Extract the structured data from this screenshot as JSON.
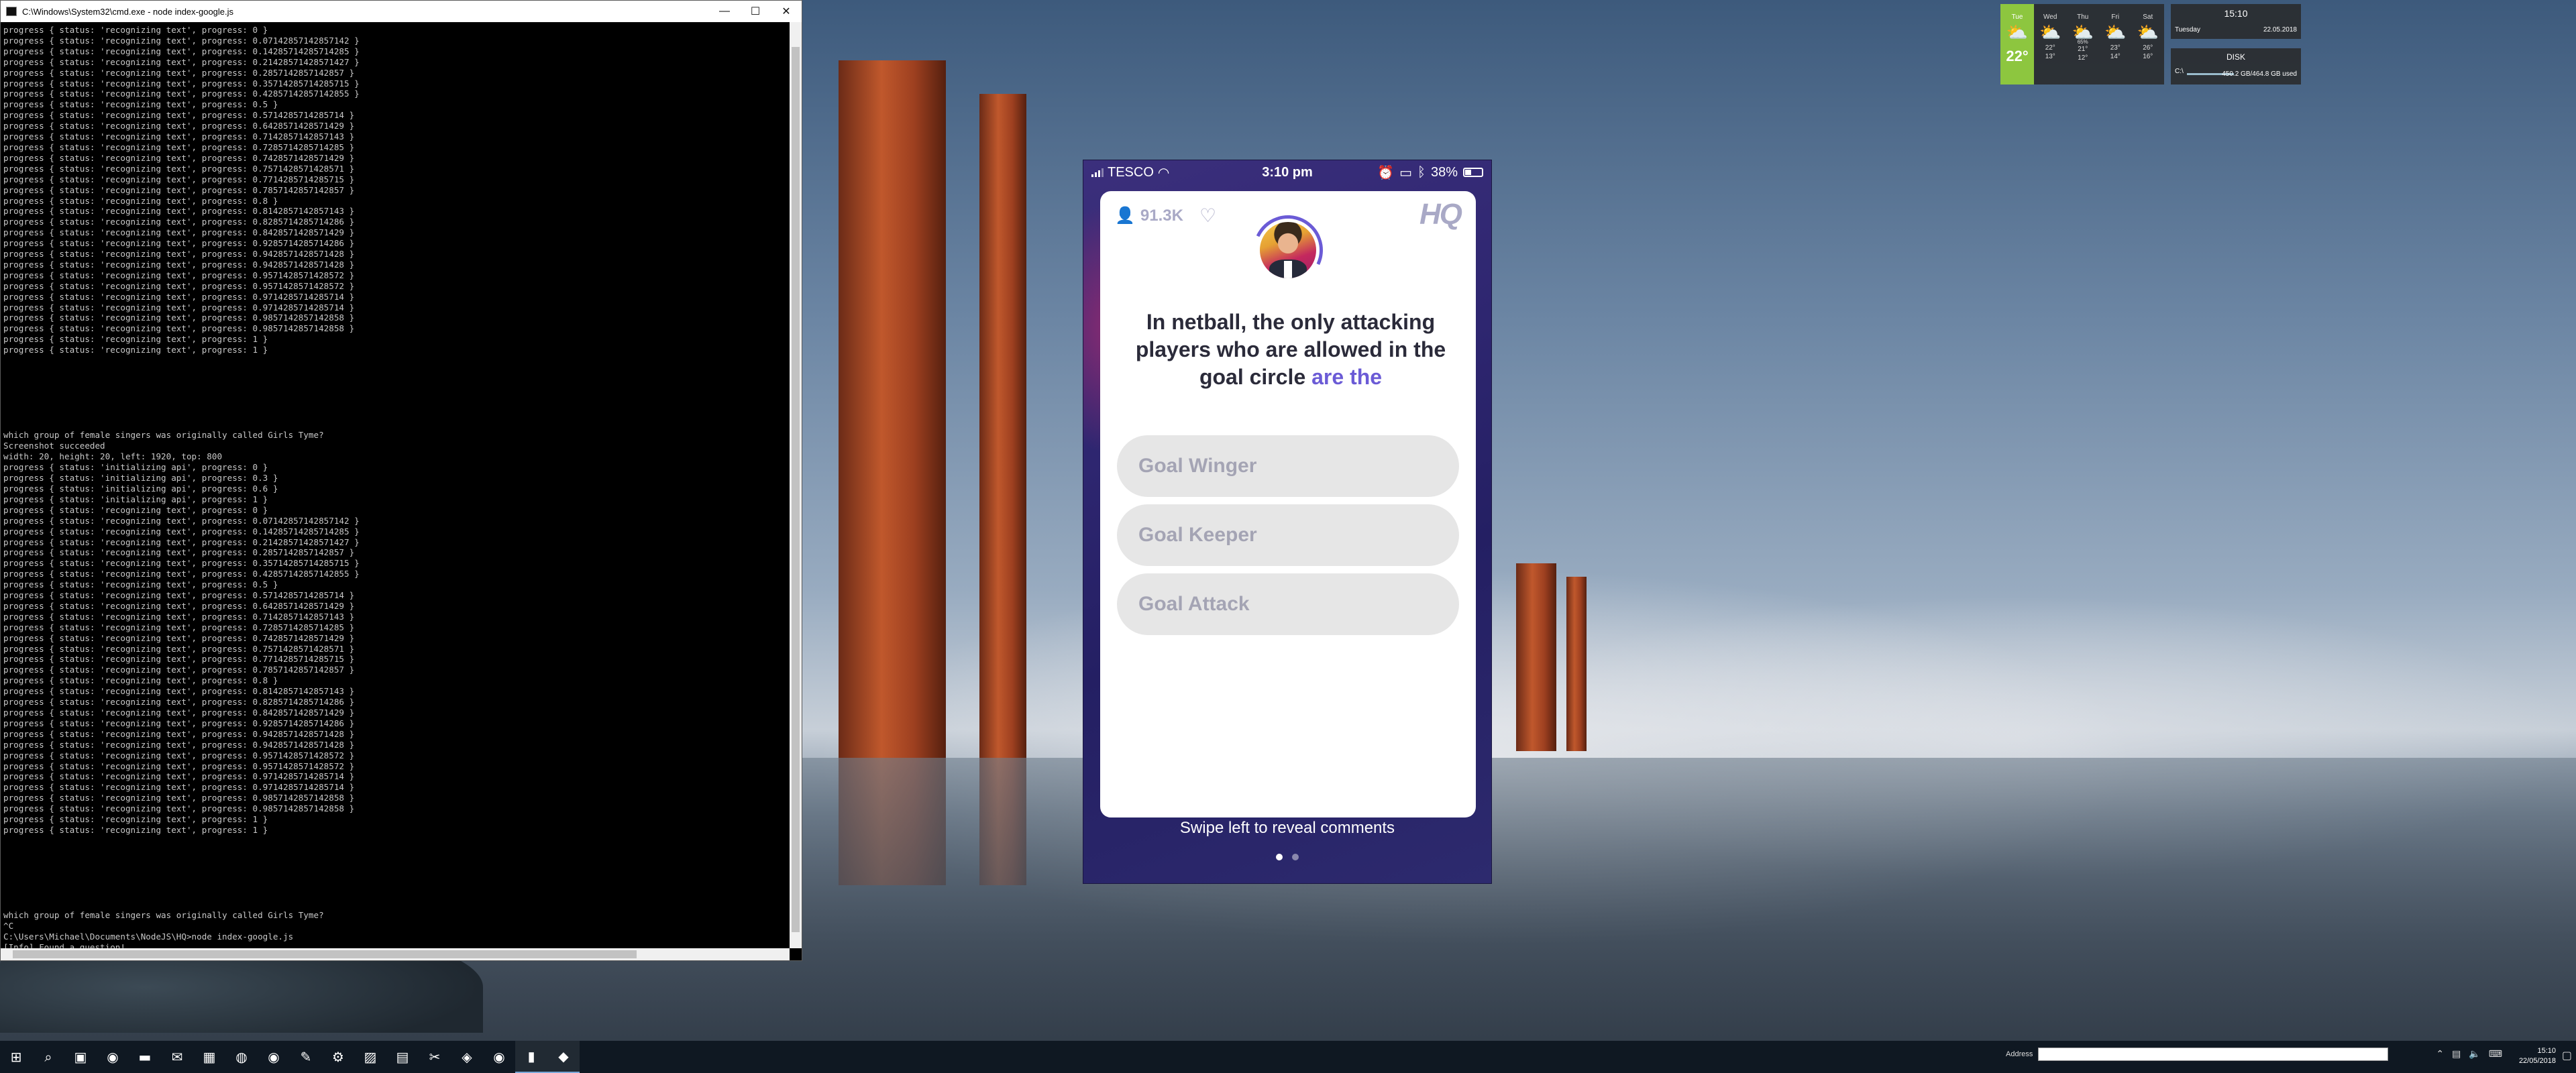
{
  "console": {
    "title": "C:\\Windows\\System32\\cmd.exe - node  index-google.js",
    "lines": [
      "progress { status: 'recognizing text', progress: 0 }",
      "progress { status: 'recognizing text', progress: 0.07142857142857142 }",
      "progress { status: 'recognizing text', progress: 0.14285714285714285 }",
      "progress { status: 'recognizing text', progress: 0.21428571428571427 }",
      "progress { status: 'recognizing text', progress: 0.2857142857142857 }",
      "progress { status: 'recognizing text', progress: 0.35714285714285715 }",
      "progress { status: 'recognizing text', progress: 0.42857142857142855 }",
      "progress { status: 'recognizing text', progress: 0.5 }",
      "progress { status: 'recognizing text', progress: 0.5714285714285714 }",
      "progress { status: 'recognizing text', progress: 0.6428571428571429 }",
      "progress { status: 'recognizing text', progress: 0.7142857142857143 }",
      "progress { status: 'recognizing text', progress: 0.7285714285714285 }",
      "progress { status: 'recognizing text', progress: 0.7428571428571429 }",
      "progress { status: 'recognizing text', progress: 0.7571428571428571 }",
      "progress { status: 'recognizing text', progress: 0.7714285714285715 }",
      "progress { status: 'recognizing text', progress: 0.7857142857142857 }",
      "progress { status: 'recognizing text', progress: 0.8 }",
      "progress { status: 'recognizing text', progress: 0.8142857142857143 }",
      "progress { status: 'recognizing text', progress: 0.8285714285714286 }",
      "progress { status: 'recognizing text', progress: 0.8428571428571429 }",
      "progress { status: 'recognizing text', progress: 0.9285714285714286 }",
      "progress { status: 'recognizing text', progress: 0.9428571428571428 }",
      "progress { status: 'recognizing text', progress: 0.9428571428571428 }",
      "progress { status: 'recognizing text', progress: 0.9571428571428572 }",
      "progress { status: 'recognizing text', progress: 0.9571428571428572 }",
      "progress { status: 'recognizing text', progress: 0.9714285714285714 }",
      "progress { status: 'recognizing text', progress: 0.9714285714285714 }",
      "progress { status: 'recognizing text', progress: 0.9857142857142858 }",
      "progress { status: 'recognizing text', progress: 0.9857142857142858 }",
      "progress { status: 'recognizing text', progress: 1 }",
      "progress { status: 'recognizing text', progress: 1 }",
      "",
      "",
      "",
      "",
      "",
      "",
      "",
      "which group of female singers was originally called Girls Tyme?",
      "Screenshot succeeded",
      "width: 20, height: 20, left: 1920, top: 800",
      "progress { status: 'initializing api', progress: 0 }",
      "progress { status: 'initializing api', progress: 0.3 }",
      "progress { status: 'initializing api', progress: 0.6 }",
      "progress { status: 'initializing api', progress: 1 }",
      "progress { status: 'recognizing text', progress: 0 }",
      "progress { status: 'recognizing text', progress: 0.07142857142857142 }",
      "progress { status: 'recognizing text', progress: 0.14285714285714285 }",
      "progress { status: 'recognizing text', progress: 0.21428571428571427 }",
      "progress { status: 'recognizing text', progress: 0.2857142857142857 }",
      "progress { status: 'recognizing text', progress: 0.35714285714285715 }",
      "progress { status: 'recognizing text', progress: 0.42857142857142855 }",
      "progress { status: 'recognizing text', progress: 0.5 }",
      "progress { status: 'recognizing text', progress: 0.5714285714285714 }",
      "progress { status: 'recognizing text', progress: 0.6428571428571429 }",
      "progress { status: 'recognizing text', progress: 0.7142857142857143 }",
      "progress { status: 'recognizing text', progress: 0.7285714285714285 }",
      "progress { status: 'recognizing text', progress: 0.7428571428571429 }",
      "progress { status: 'recognizing text', progress: 0.7571428571428571 }",
      "progress { status: 'recognizing text', progress: 0.7714285714285715 }",
      "progress { status: 'recognizing text', progress: 0.7857142857142857 }",
      "progress { status: 'recognizing text', progress: 0.8 }",
      "progress { status: 'recognizing text', progress: 0.8142857142857143 }",
      "progress { status: 'recognizing text', progress: 0.8285714285714286 }",
      "progress { status: 'recognizing text', progress: 0.8428571428571429 }",
      "progress { status: 'recognizing text', progress: 0.9285714285714286 }",
      "progress { status: 'recognizing text', progress: 0.9428571428571428 }",
      "progress { status: 'recognizing text', progress: 0.9428571428571428 }",
      "progress { status: 'recognizing text', progress: 0.9571428571428572 }",
      "progress { status: 'recognizing text', progress: 0.9571428571428572 }",
      "progress { status: 'recognizing text', progress: 0.9714285714285714 }",
      "progress { status: 'recognizing text', progress: 0.9714285714285714 }",
      "progress { status: 'recognizing text', progress: 0.9857142857142858 }",
      "progress { status: 'recognizing text', progress: 0.9857142857142858 }",
      "progress { status: 'recognizing text', progress: 1 }",
      "progress { status: 'recognizing text', progress: 1 }",
      "",
      "",
      "",
      "",
      "",
      "",
      "",
      "which group of female singers was originally called Girls Tyme?",
      "^C",
      "C:\\Users\\Michael\\Documents\\NodeJS\\HQ>node index-google.js",
      "[Info] Found a question!"
    ]
  },
  "phone": {
    "carrier": "TESCO",
    "time": "3:10 pm",
    "battery": "38%",
    "battery_level": 0.38,
    "viewers": "91.3K",
    "logo": "HQ",
    "question_main": "In netball, the only attacking players who are allowed in the goal circle ",
    "question_highlight": "are the",
    "answers": [
      "Goal Winger",
      "Goal Keeper",
      "Goal Attack"
    ],
    "swipe_hint": "Swipe left to reveal comments",
    "accent_color": "#6b5bd6"
  },
  "weather": {
    "days": [
      {
        "name": "Tue",
        "temp": "22°",
        "hi": "",
        "lo": "",
        "today": true
      },
      {
        "name": "Wed",
        "hi": "22°",
        "lo": "13°"
      },
      {
        "name": "Thu",
        "hi": "21°",
        "lo": "12°",
        "note": "65%"
      },
      {
        "name": "Fri",
        "hi": "23°",
        "lo": "14°"
      },
      {
        "name": "Sat",
        "hi": "26°",
        "lo": "16°"
      }
    ]
  },
  "clock_widget": {
    "time": "15:10",
    "day": "Tuesday",
    "date": "22.05.2018"
  },
  "disk_widget": {
    "title": "DISK",
    "drive": "C:\\",
    "usage": "450.2 GB/464.8 GB used",
    "usage_fraction": 0.97
  },
  "taskbar": {
    "address_label": "Address",
    "time": "15:10",
    "date": "22/05/2018",
    "icons": [
      "windows-start-icon",
      "search-icon",
      "task-view-icon",
      "chrome-icon",
      "file-explorer-icon",
      "outlook-icon",
      "excel-icon",
      "xbox-icon",
      "chrome-icon",
      "paint-icon",
      "settings-icon",
      "photos-icon",
      "store-icon",
      "snip-icon",
      "visual-studio-icon",
      "chrome-icon",
      "terminal-icon",
      "hq-app-icon"
    ]
  }
}
